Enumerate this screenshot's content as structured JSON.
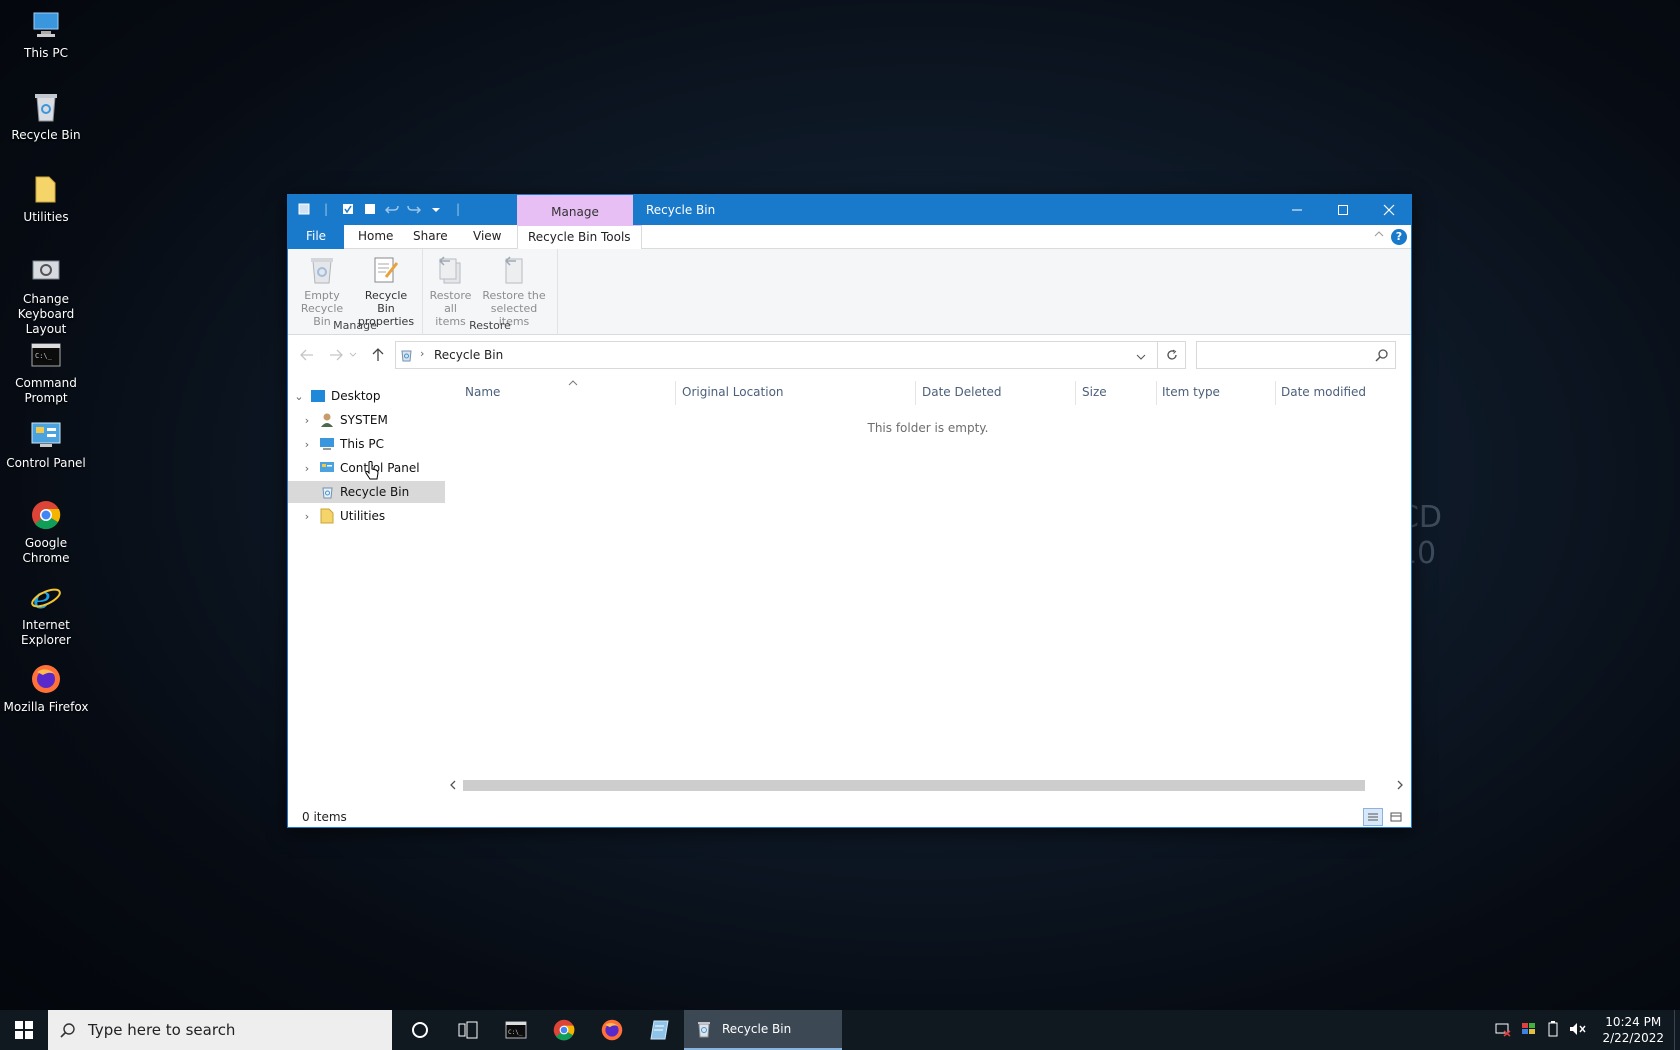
{
  "desktop": {
    "icons": [
      {
        "label": "This PC"
      },
      {
        "label": "Recycle Bin"
      },
      {
        "label": "Utilities"
      },
      {
        "label": "Change Keyboard Layout"
      },
      {
        "label": "Command Prompt"
      },
      {
        "label": "Control Panel"
      },
      {
        "label": "Google Chrome"
      },
      {
        "label": "Internet Explorer"
      },
      {
        "label": "Mozilla Firefox"
      }
    ],
    "wallpaper_text": [
      "CD",
      "10"
    ]
  },
  "window": {
    "title": "Recycle Bin",
    "context_tab_group": "Manage",
    "tabs": {
      "file": "File",
      "home": "Home",
      "share": "Share",
      "view": "View",
      "tools": "Recycle Bin Tools"
    },
    "ribbon": {
      "manage_group": "Manage",
      "restore_group": "Restore",
      "empty_bin": "Empty Recycle Bin",
      "properties": "Recycle Bin properties",
      "restore_all": "Restore all items",
      "restore_selected": "Restore the selected items"
    },
    "address": {
      "crumb": "Recycle Bin",
      "search_placeholder": ""
    },
    "tree": {
      "desktop": "Desktop",
      "system": "SYSTEM",
      "this_pc": "This PC",
      "control_panel": "Control Panel",
      "recycle_bin": "Recycle Bin",
      "utilities": "Utilities"
    },
    "columns": {
      "name": "Name",
      "original_location": "Original Location",
      "date_deleted": "Date Deleted",
      "size": "Size",
      "item_type": "Item type",
      "date_modified": "Date modified"
    },
    "empty_message": "This folder is empty.",
    "status": "0 items"
  },
  "taskbar": {
    "search_placeholder": "Type here to search",
    "active_app": "Recycle Bin",
    "time": "10:24 PM",
    "date": "2/22/2022"
  },
  "colors": {
    "title_bar": "#1979ca",
    "context_tab": "#e7bff4",
    "taskbar": "#101820"
  }
}
